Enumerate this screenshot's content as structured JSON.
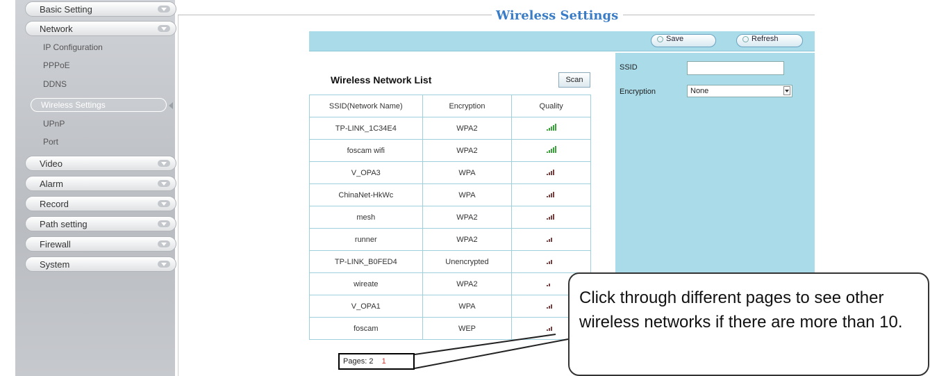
{
  "sidebar": {
    "categories": [
      {
        "label": "Basic Setting"
      },
      {
        "label": "Network"
      },
      {
        "label": "Video"
      },
      {
        "label": "Alarm"
      },
      {
        "label": "Record"
      },
      {
        "label": "Path setting"
      },
      {
        "label": "Firewall"
      },
      {
        "label": "System"
      }
    ],
    "network_items": [
      {
        "label": "IP Configuration"
      },
      {
        "label": "PPPoE"
      },
      {
        "label": "DDNS"
      },
      {
        "label": "Wireless Settings"
      },
      {
        "label": "UPnP"
      },
      {
        "label": "Port"
      }
    ]
  },
  "header": {
    "title": "Wireless Settings"
  },
  "toolbar": {
    "save_label": "Save",
    "refresh_label": "Refresh"
  },
  "form": {
    "ssid_label": "SSID",
    "ssid_value": "",
    "encryption_label": "Encryption",
    "encryption_value": "None"
  },
  "list": {
    "title": "Wireless Network List",
    "scan_label": "Scan",
    "columns": [
      "SSID(Network Name)",
      "Encryption",
      "Quality"
    ],
    "rows": [
      {
        "ssid": "TP-LINK_1C34E4",
        "encryption": "WPA2",
        "quality": 5
      },
      {
        "ssid": "foscam wifi",
        "encryption": "WPA2",
        "quality": 5
      },
      {
        "ssid": "V_OPA3",
        "encryption": "WPA",
        "quality": 4
      },
      {
        "ssid": "ChinaNet-HkWc",
        "encryption": "WPA",
        "quality": 4
      },
      {
        "ssid": "mesh",
        "encryption": "WPA2",
        "quality": 4
      },
      {
        "ssid": "runner",
        "encryption": "WPA2",
        "quality": 3
      },
      {
        "ssid": "TP-LINK_B0FED4",
        "encryption": "Unencrypted",
        "quality": 3
      },
      {
        "ssid": "wireate",
        "encryption": "WPA2",
        "quality": 2
      },
      {
        "ssid": "V_OPA1",
        "encryption": "WPA",
        "quality": 3
      },
      {
        "ssid": "foscam",
        "encryption": "WEP",
        "quality": 3
      }
    ]
  },
  "pager": {
    "label": "Pages:",
    "page1": "1",
    "page2": "2"
  },
  "callout": {
    "text": "Click through different pages to see other wireless networks if there are more than 10."
  },
  "colors": {
    "accent": "#3a7dc6",
    "panel": "#a9dbe9",
    "signal_good": "#3aa33a",
    "signal_weak": "#7a4040"
  }
}
